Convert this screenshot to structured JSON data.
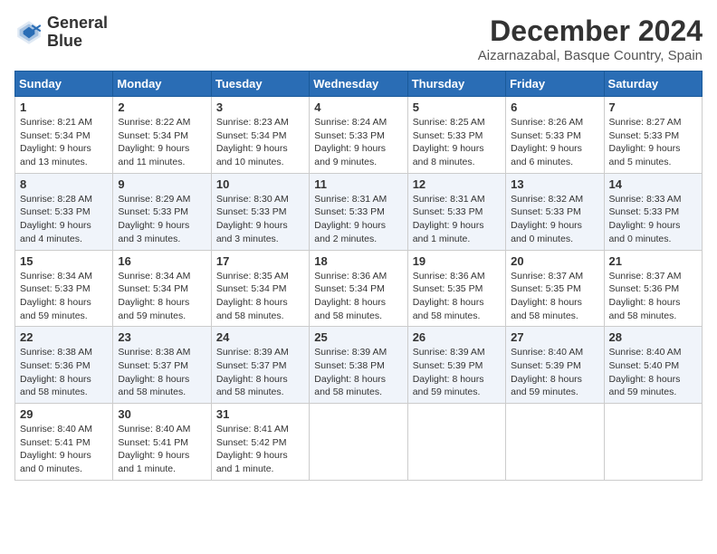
{
  "logo": {
    "line1": "General",
    "line2": "Blue"
  },
  "title": "December 2024",
  "subtitle": "Aizarnazabal, Basque Country, Spain",
  "days_header": [
    "Sunday",
    "Monday",
    "Tuesday",
    "Wednesday",
    "Thursday",
    "Friday",
    "Saturday"
  ],
  "weeks": [
    [
      {
        "day": "1",
        "sunrise": "8:21 AM",
        "sunset": "5:34 PM",
        "daylight": "9 hours and 13 minutes."
      },
      {
        "day": "2",
        "sunrise": "8:22 AM",
        "sunset": "5:34 PM",
        "daylight": "9 hours and 11 minutes."
      },
      {
        "day": "3",
        "sunrise": "8:23 AM",
        "sunset": "5:34 PM",
        "daylight": "9 hours and 10 minutes."
      },
      {
        "day": "4",
        "sunrise": "8:24 AM",
        "sunset": "5:33 PM",
        "daylight": "9 hours and 9 minutes."
      },
      {
        "day": "5",
        "sunrise": "8:25 AM",
        "sunset": "5:33 PM",
        "daylight": "9 hours and 8 minutes."
      },
      {
        "day": "6",
        "sunrise": "8:26 AM",
        "sunset": "5:33 PM",
        "daylight": "9 hours and 6 minutes."
      },
      {
        "day": "7",
        "sunrise": "8:27 AM",
        "sunset": "5:33 PM",
        "daylight": "9 hours and 5 minutes."
      }
    ],
    [
      {
        "day": "8",
        "sunrise": "8:28 AM",
        "sunset": "5:33 PM",
        "daylight": "9 hours and 4 minutes."
      },
      {
        "day": "9",
        "sunrise": "8:29 AM",
        "sunset": "5:33 PM",
        "daylight": "9 hours and 3 minutes."
      },
      {
        "day": "10",
        "sunrise": "8:30 AM",
        "sunset": "5:33 PM",
        "daylight": "9 hours and 3 minutes."
      },
      {
        "day": "11",
        "sunrise": "8:31 AM",
        "sunset": "5:33 PM",
        "daylight": "9 hours and 2 minutes."
      },
      {
        "day": "12",
        "sunrise": "8:31 AM",
        "sunset": "5:33 PM",
        "daylight": "9 hours and 1 minute."
      },
      {
        "day": "13",
        "sunrise": "8:32 AM",
        "sunset": "5:33 PM",
        "daylight": "9 hours and 0 minutes."
      },
      {
        "day": "14",
        "sunrise": "8:33 AM",
        "sunset": "5:33 PM",
        "daylight": "9 hours and 0 minutes."
      }
    ],
    [
      {
        "day": "15",
        "sunrise": "8:34 AM",
        "sunset": "5:33 PM",
        "daylight": "8 hours and 59 minutes."
      },
      {
        "day": "16",
        "sunrise": "8:34 AM",
        "sunset": "5:34 PM",
        "daylight": "8 hours and 59 minutes."
      },
      {
        "day": "17",
        "sunrise": "8:35 AM",
        "sunset": "5:34 PM",
        "daylight": "8 hours and 58 minutes."
      },
      {
        "day": "18",
        "sunrise": "8:36 AM",
        "sunset": "5:34 PM",
        "daylight": "8 hours and 58 minutes."
      },
      {
        "day": "19",
        "sunrise": "8:36 AM",
        "sunset": "5:35 PM",
        "daylight": "8 hours and 58 minutes."
      },
      {
        "day": "20",
        "sunrise": "8:37 AM",
        "sunset": "5:35 PM",
        "daylight": "8 hours and 58 minutes."
      },
      {
        "day": "21",
        "sunrise": "8:37 AM",
        "sunset": "5:36 PM",
        "daylight": "8 hours and 58 minutes."
      }
    ],
    [
      {
        "day": "22",
        "sunrise": "8:38 AM",
        "sunset": "5:36 PM",
        "daylight": "8 hours and 58 minutes."
      },
      {
        "day": "23",
        "sunrise": "8:38 AM",
        "sunset": "5:37 PM",
        "daylight": "8 hours and 58 minutes."
      },
      {
        "day": "24",
        "sunrise": "8:39 AM",
        "sunset": "5:37 PM",
        "daylight": "8 hours and 58 minutes."
      },
      {
        "day": "25",
        "sunrise": "8:39 AM",
        "sunset": "5:38 PM",
        "daylight": "8 hours and 58 minutes."
      },
      {
        "day": "26",
        "sunrise": "8:39 AM",
        "sunset": "5:39 PM",
        "daylight": "8 hours and 59 minutes."
      },
      {
        "day": "27",
        "sunrise": "8:40 AM",
        "sunset": "5:39 PM",
        "daylight": "8 hours and 59 minutes."
      },
      {
        "day": "28",
        "sunrise": "8:40 AM",
        "sunset": "5:40 PM",
        "daylight": "8 hours and 59 minutes."
      }
    ],
    [
      {
        "day": "29",
        "sunrise": "8:40 AM",
        "sunset": "5:41 PM",
        "daylight": "9 hours and 0 minutes."
      },
      {
        "day": "30",
        "sunrise": "8:40 AM",
        "sunset": "5:41 PM",
        "daylight": "9 hours and 1 minute."
      },
      {
        "day": "31",
        "sunrise": "8:41 AM",
        "sunset": "5:42 PM",
        "daylight": "9 hours and 1 minute."
      },
      null,
      null,
      null,
      null
    ]
  ]
}
